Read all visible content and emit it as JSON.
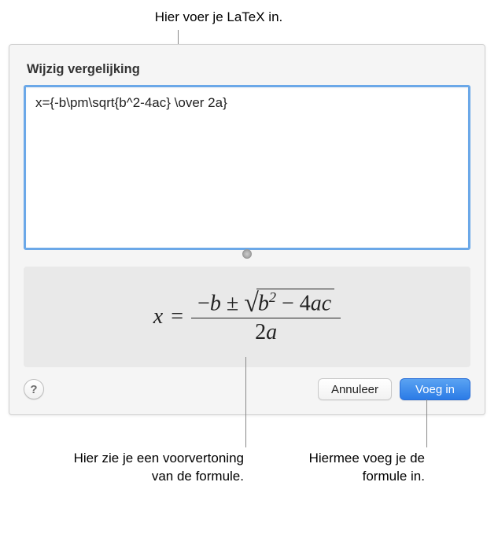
{
  "callouts": {
    "top": "Hier voer je LaTeX in.",
    "bottom_left": "Hier zie je een voorvertoning van de formule.",
    "bottom_right": "Hiermee voeg je de formule in."
  },
  "panel": {
    "title": "Wijzig vergelijking",
    "latex_input": "x={-b\\pm\\sqrt{b^2-4ac} \\over 2a}",
    "preview": {
      "lhs_var": "x",
      "pm": "±",
      "minus": "−",
      "b": "b",
      "sup2": "2",
      "four": "4",
      "a": "a",
      "c": "c",
      "two": "2",
      "eq": "="
    },
    "buttons": {
      "help": "?",
      "cancel": "Annuleer",
      "insert": "Voeg in"
    }
  }
}
